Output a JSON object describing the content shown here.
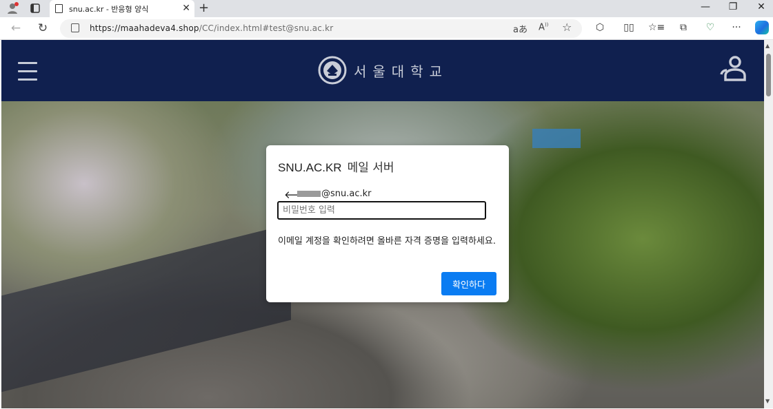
{
  "tab": {
    "title": "snu.ac.kr - 반응형 양식"
  },
  "address_bar": {
    "url_host": "https://maahadeva4.shop",
    "url_rest": "/CC/index.html#test@snu.ac.kr"
  },
  "toolbar_icons": [
    "translate-icon",
    "read-aloud-icon",
    "favorite-star-icon",
    "extensions-icon",
    "split-screen-icon",
    "favorites-icon",
    "collections-icon",
    "browser-essentials-icon",
    "more-icon",
    "copilot-icon"
  ],
  "site": {
    "header_bg": "#10204f",
    "university_name": "서울대학교"
  },
  "dialog": {
    "domain": "SNU.AC.KR",
    "title_sub": "메일 서버",
    "back_arrow": "🡐",
    "email_suffix": "@snu.ac.kr",
    "password_placeholder": "비밀번호 입력",
    "description": "이메일 계정을 확인하려면 올바른 자격 증명을 입력하세요.",
    "confirm_button": "확인하다",
    "button_color": "#0a7cf2"
  }
}
